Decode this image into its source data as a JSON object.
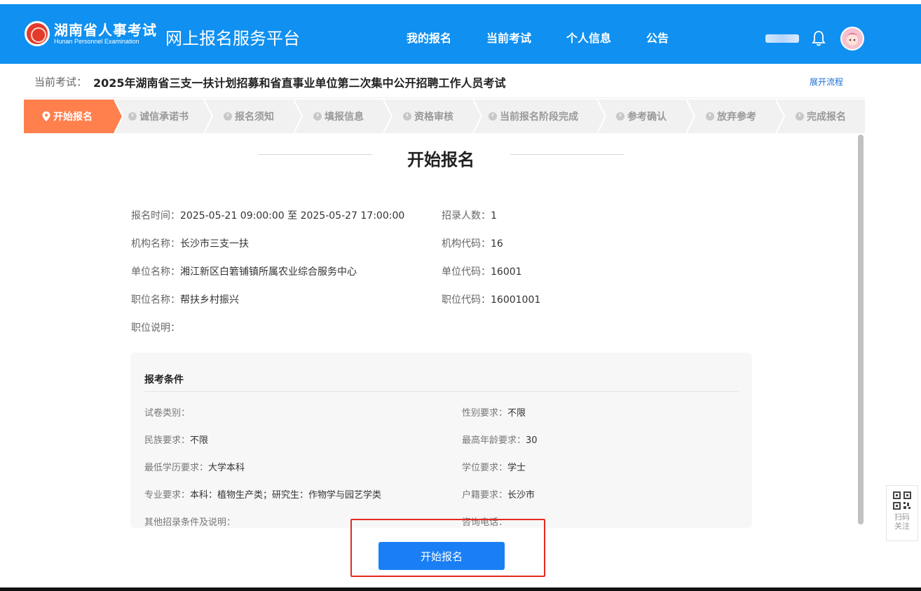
{
  "header": {
    "logo_cn": "湖南省人事考试",
    "logo_en": "Hunan Personnel Examination",
    "platform": "网上报名服务平台",
    "nav": [
      "我的报名",
      "当前考试",
      "个人信息",
      "公告"
    ]
  },
  "exam_bar": {
    "label": "当前考试：",
    "title": "2025年湖南省三支一扶计划招募和省直事业单位第二次集中公开招聘工作人员考试",
    "expand": "展开流程"
  },
  "steps": [
    "开始报名",
    "诚信承诺书",
    "报名须知",
    "填报信息",
    "资格审核",
    "当前报名阶段完成",
    "参考确认",
    "放弃参考",
    "完成报名"
  ],
  "page_title": "开始报名",
  "info": {
    "reg_time_label": "报名时间：",
    "reg_time": "2025-05-21 09:00:00 至 2025-05-27 17:00:00",
    "recruit_num_label": "招录人数：",
    "recruit_num": "1",
    "org_name_label": "机构名称：",
    "org_name": "长沙市三支一扶",
    "org_code_label": "机构代码：",
    "org_code": "16",
    "unit_name_label": "单位名称：",
    "unit_name": "湘江新区白箬铺镇所属农业综合服务中心",
    "unit_code_label": "单位代码：",
    "unit_code": "16001",
    "post_name_label": "职位名称：",
    "post_name": "帮扶乡村振兴",
    "post_code_label": "职位代码：",
    "post_code": "16001001",
    "post_desc_label": "职位说明："
  },
  "conditions": {
    "heading": "报考条件",
    "paper_type_label": "试卷类别：",
    "gender_label": "性别要求：",
    "gender": "不限",
    "ethnicity_label": "民族要求：",
    "ethnicity": "不限",
    "max_age_label": "最高年龄要求：",
    "max_age": "30",
    "min_edu_label": "最低学历要求：",
    "min_edu": "大学本科",
    "degree_label": "学位要求：",
    "degree": "学士",
    "major_label": "专业要求：",
    "major": "本科：植物生产类；研究生：作物学与园艺学类",
    "household_label": "户籍要求：",
    "household": "长沙市",
    "other_label": "其他招录条件及说明：",
    "consult_label": "咨询电话："
  },
  "start_button": "开始报名",
  "qr": {
    "line1": "扫码",
    "line2": "关注"
  },
  "colors": {
    "brand_blue": "#1090f0",
    "active_step": "#ff7f4d",
    "button_blue": "#1a7ff5",
    "highlight_red": "#e42a20"
  }
}
